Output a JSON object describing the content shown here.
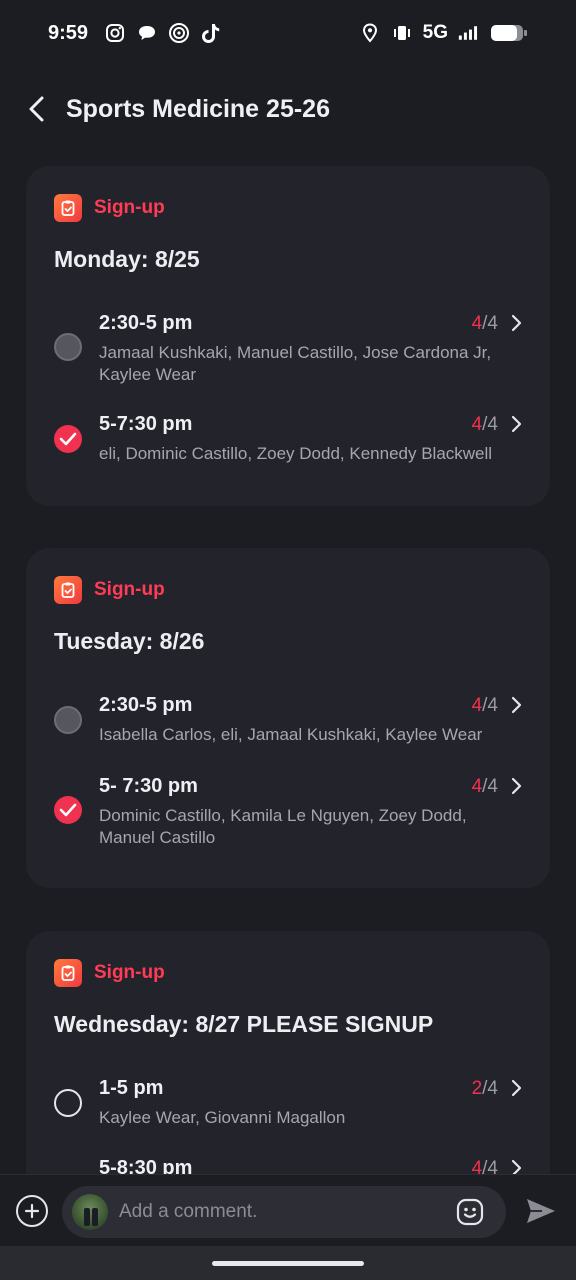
{
  "status_bar": {
    "time": "9:59",
    "network": "5G",
    "left_icons": [
      "instagram-icon",
      "chat-icon",
      "threads-icon",
      "tiktok-icon"
    ],
    "right_icons": [
      "location-icon",
      "vibrate-icon",
      "signal-icon",
      "battery-icon"
    ]
  },
  "header": {
    "title": "Sports Medicine 25-26"
  },
  "cards": [
    {
      "tag": "Sign-up",
      "title": "Monday: 8/25",
      "slots": [
        {
          "time": "2:30-5 pm",
          "count": "4",
          "capacity": "/4",
          "names": "Jamaal Kushkaki, Manuel Castillo, Jose Cardona Jr, Kaylee Wear",
          "state": "filled"
        },
        {
          "time": "5-7:30 pm",
          "count": "4",
          "capacity": "/4",
          "names": "eli, Dominic Castillo, Zoey Dodd, Kennedy Blackwell",
          "state": "checked"
        }
      ]
    },
    {
      "tag": "Sign-up",
      "title": "Tuesday: 8/26",
      "slots": [
        {
          "time": "2:30-5 pm",
          "count": "4",
          "capacity": "/4",
          "names": "Isabella Carlos, eli, Jamaal Kushkaki, Kaylee Wear",
          "state": "filled"
        },
        {
          "time": "5- 7:30 pm",
          "count": "4",
          "capacity": "/4",
          "names": "Dominic Castillo, Kamila Le Nguyen, Zoey Dodd, Manuel Castillo",
          "state": "checked"
        }
      ]
    },
    {
      "tag": "Sign-up",
      "title": "Wednesday: 8/27 PLEASE SIGNUP",
      "slots": [
        {
          "time": "1-5 pm",
          "count": "2",
          "capacity": "/4",
          "names": "Kaylee Wear, Giovanni Magallon",
          "state": "empty"
        },
        {
          "time": "5-8:30 pm",
          "count": "4",
          "capacity": "/4",
          "names": "",
          "state": "hidden"
        }
      ]
    }
  ],
  "comment_bar": {
    "placeholder": "Add a comment."
  },
  "colors": {
    "accent": "#f0314f",
    "background": "#1c1d22",
    "card": "#23242b",
    "muted_text": "#a6a7ae"
  }
}
